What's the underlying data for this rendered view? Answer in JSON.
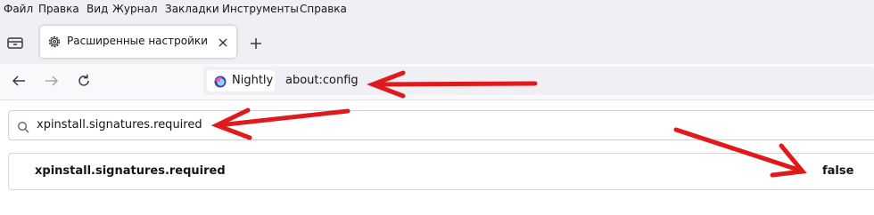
{
  "menubar": {
    "items": [
      {
        "label": "Файл"
      },
      {
        "label": "Правка"
      },
      {
        "label": "Вид"
      },
      {
        "label": "Журнал"
      },
      {
        "label": "Закладки"
      },
      {
        "label": "Инструменты"
      },
      {
        "label": "Справка"
      }
    ]
  },
  "tabs": [
    {
      "label": "Расширенные настройки",
      "icon": "gear-icon",
      "active": true
    }
  ],
  "urlbar": {
    "identity_label": "Nightly",
    "url": "about:config"
  },
  "search": {
    "value": "xpinstall.signatures.required"
  },
  "prefs": [
    {
      "name": "xpinstall.signatures.required",
      "value": "false"
    }
  ],
  "colors": {
    "annotation_arrow": "#e0191c",
    "chrome_bg": "#f0f0f4",
    "nav_bg": "#f9f9fb"
  }
}
